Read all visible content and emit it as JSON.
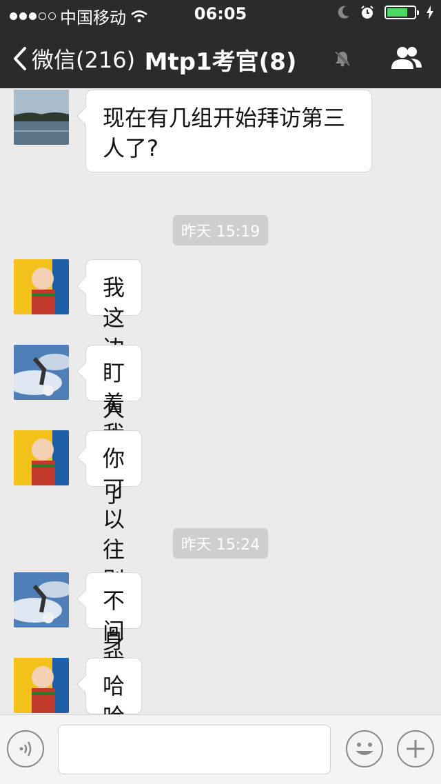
{
  "status_bar": {
    "carrier": "中国移动",
    "time": "06:05",
    "battery_level": 0.75,
    "icons": [
      "signal-dots-icon",
      "wifi-icon",
      "moon-icon",
      "alarm-icon",
      "battery-icon",
      "charging-icon"
    ]
  },
  "nav": {
    "back_label": "微信(216)",
    "title": "Mtp1考官(8)",
    "icons": [
      "chevron-left-icon",
      "mute-bell-icon",
      "group-members-icon"
    ]
  },
  "messages": [
    {
      "avatar": "lake-avatar",
      "text_line1": "现在有几组开始拜访第三",
      "text_line2": "人了?"
    },
    {
      "timestamp": "昨天 15:19"
    },
    {
      "avatar": "baby-avatar",
      "text": "我这边没人来"
    },
    {
      "avatar": "sky-avatar",
      "text": "盯着我搞了"
    },
    {
      "avatar": "baby-avatar",
      "text": "你可以往别人身上引引"
    },
    {
      "timestamp": "昨天 15:24"
    },
    {
      "avatar": "sky-avatar",
      "text": "不问我怎么引呀"
    },
    {
      "avatar": "baby-avatar",
      "text": "哈哈"
    }
  ],
  "input_bar": {
    "placeholder": "",
    "icons": [
      "voice-icon",
      "emoji-icon",
      "plus-icon"
    ]
  },
  "colors": {
    "bar_bg": "#2b2b2b",
    "chat_bg": "#ebebeb",
    "battery_green": "#4cd964",
    "timestamp_bg": "#cecece"
  }
}
